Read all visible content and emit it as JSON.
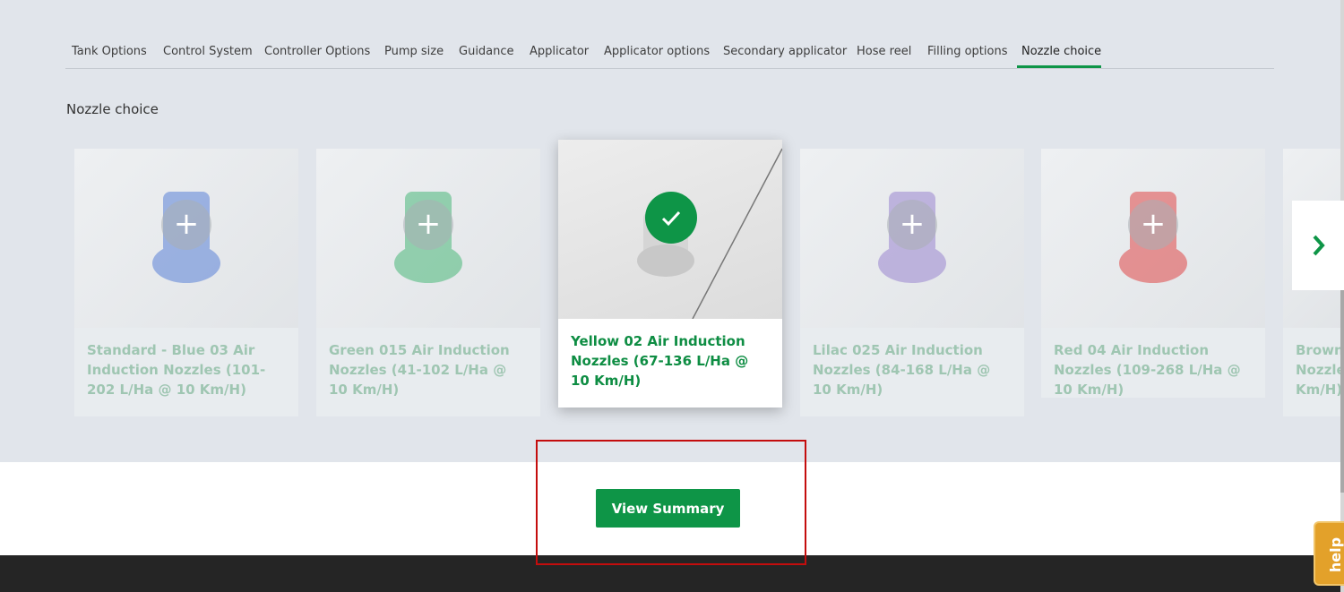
{
  "tabs": {
    "items": [
      {
        "label": "Tank Options"
      },
      {
        "label": "Control System"
      },
      {
        "label": "Controller Options"
      },
      {
        "label": "Pump size"
      },
      {
        "label": "Guidance"
      },
      {
        "label": "Applicator"
      },
      {
        "label": "Applicator options"
      },
      {
        "label": "Secondary applicator"
      },
      {
        "label": "Hose reel"
      },
      {
        "label": "Filling options"
      },
      {
        "label": "Nozzle choice"
      }
    ],
    "active": "Nozzle choice"
  },
  "section": {
    "title": "Nozzle choice"
  },
  "cards": [
    {
      "label": "Standard - Blue 03 Air Induction Nozzles (101-202 L/Ha @ 10 Km/H)",
      "color": "#5b82d8",
      "selected": false,
      "icon": "plus-icon"
    },
    {
      "label": "Green 015 Air Induction Nozzles (41-102 L/Ha @ 10 Km/H)",
      "color": "#4bb87a",
      "selected": false,
      "icon": "plus-icon"
    },
    {
      "label": "Yellow 02 Air Induction Nozzles (67-136 L/Ha @ 10 Km/H)",
      "color": "#cfcfcf",
      "selected": true,
      "icon": "check-icon"
    },
    {
      "label": "Lilac 025 Air Induction Nozzles (84-168 L/Ha @ 10 Km/H)",
      "color": "#9a86d0",
      "selected": false,
      "icon": "plus-icon"
    },
    {
      "label": "Red 04 Air Induction Nozzles (109-268 L/Ha @ 10 Km/H)",
      "color": "#e04848",
      "selected": false,
      "icon": "plus-icon"
    },
    {
      "label": "Brown Nozzle Km/H)",
      "color": "#9b6a45",
      "selected": false,
      "icon": "plus-icon"
    }
  ],
  "navigation": {
    "next_icon": "chevron-right-icon"
  },
  "actions": {
    "view_summary": "View Summary"
  },
  "help": {
    "label": "help"
  },
  "colors": {
    "accent": "#0e9547",
    "highlight": "#c40d0d",
    "footer": "#252525",
    "help": "#e3a12a"
  }
}
